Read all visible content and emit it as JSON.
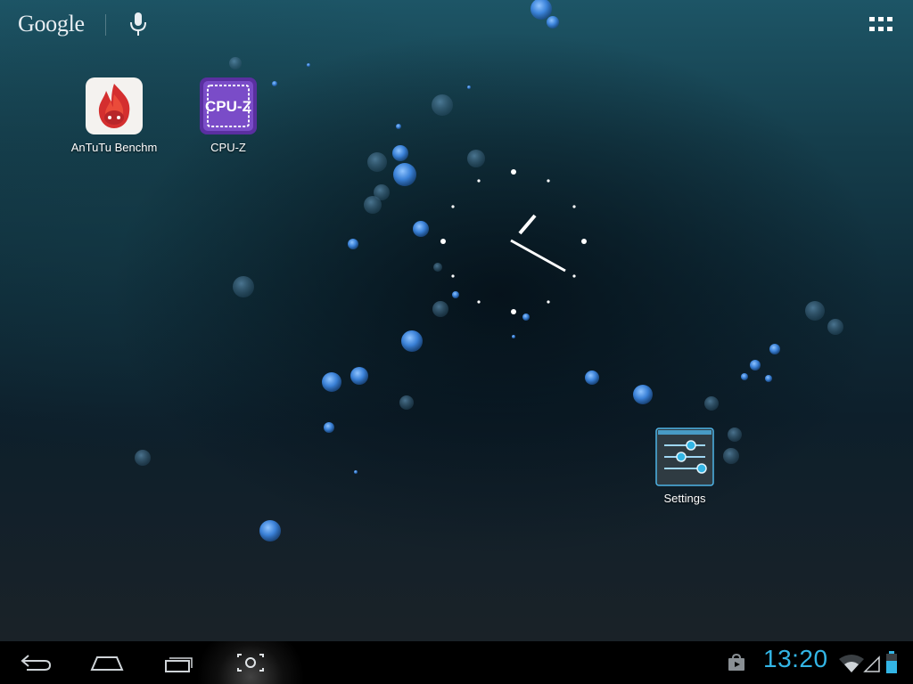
{
  "search_bar": {
    "google_label": "Google",
    "mic_icon": "microphone-icon",
    "apps_icon": "all-apps-grid-icon"
  },
  "apps": [
    {
      "label": "AnTuTu Benchm",
      "icon": "antutu-flame-icon",
      "accent": "#d42f2f"
    },
    {
      "label": "CPU-Z",
      "icon": "cpu-z-chip-icon",
      "accent": "#6a3fb0",
      "icon_text": "CPU-Z"
    },
    {
      "label": "Settings",
      "icon": "settings-sliders-icon",
      "accent": "#33b5e5"
    }
  ],
  "clock_widget": {
    "type": "analog",
    "time": "13:20"
  },
  "nav_bar": {
    "back_icon": "back-icon",
    "home_icon": "home-icon",
    "recents_icon": "recent-apps-icon",
    "screenshot_icon": "screenshot-icon"
  },
  "status": {
    "time": "13:20",
    "store_icon": "play-store-bag-icon",
    "wifi_icon": "wifi-icon",
    "signal_icon": "cell-signal-icon",
    "battery_icon": "battery-icon",
    "accent": "#33b5e5"
  }
}
